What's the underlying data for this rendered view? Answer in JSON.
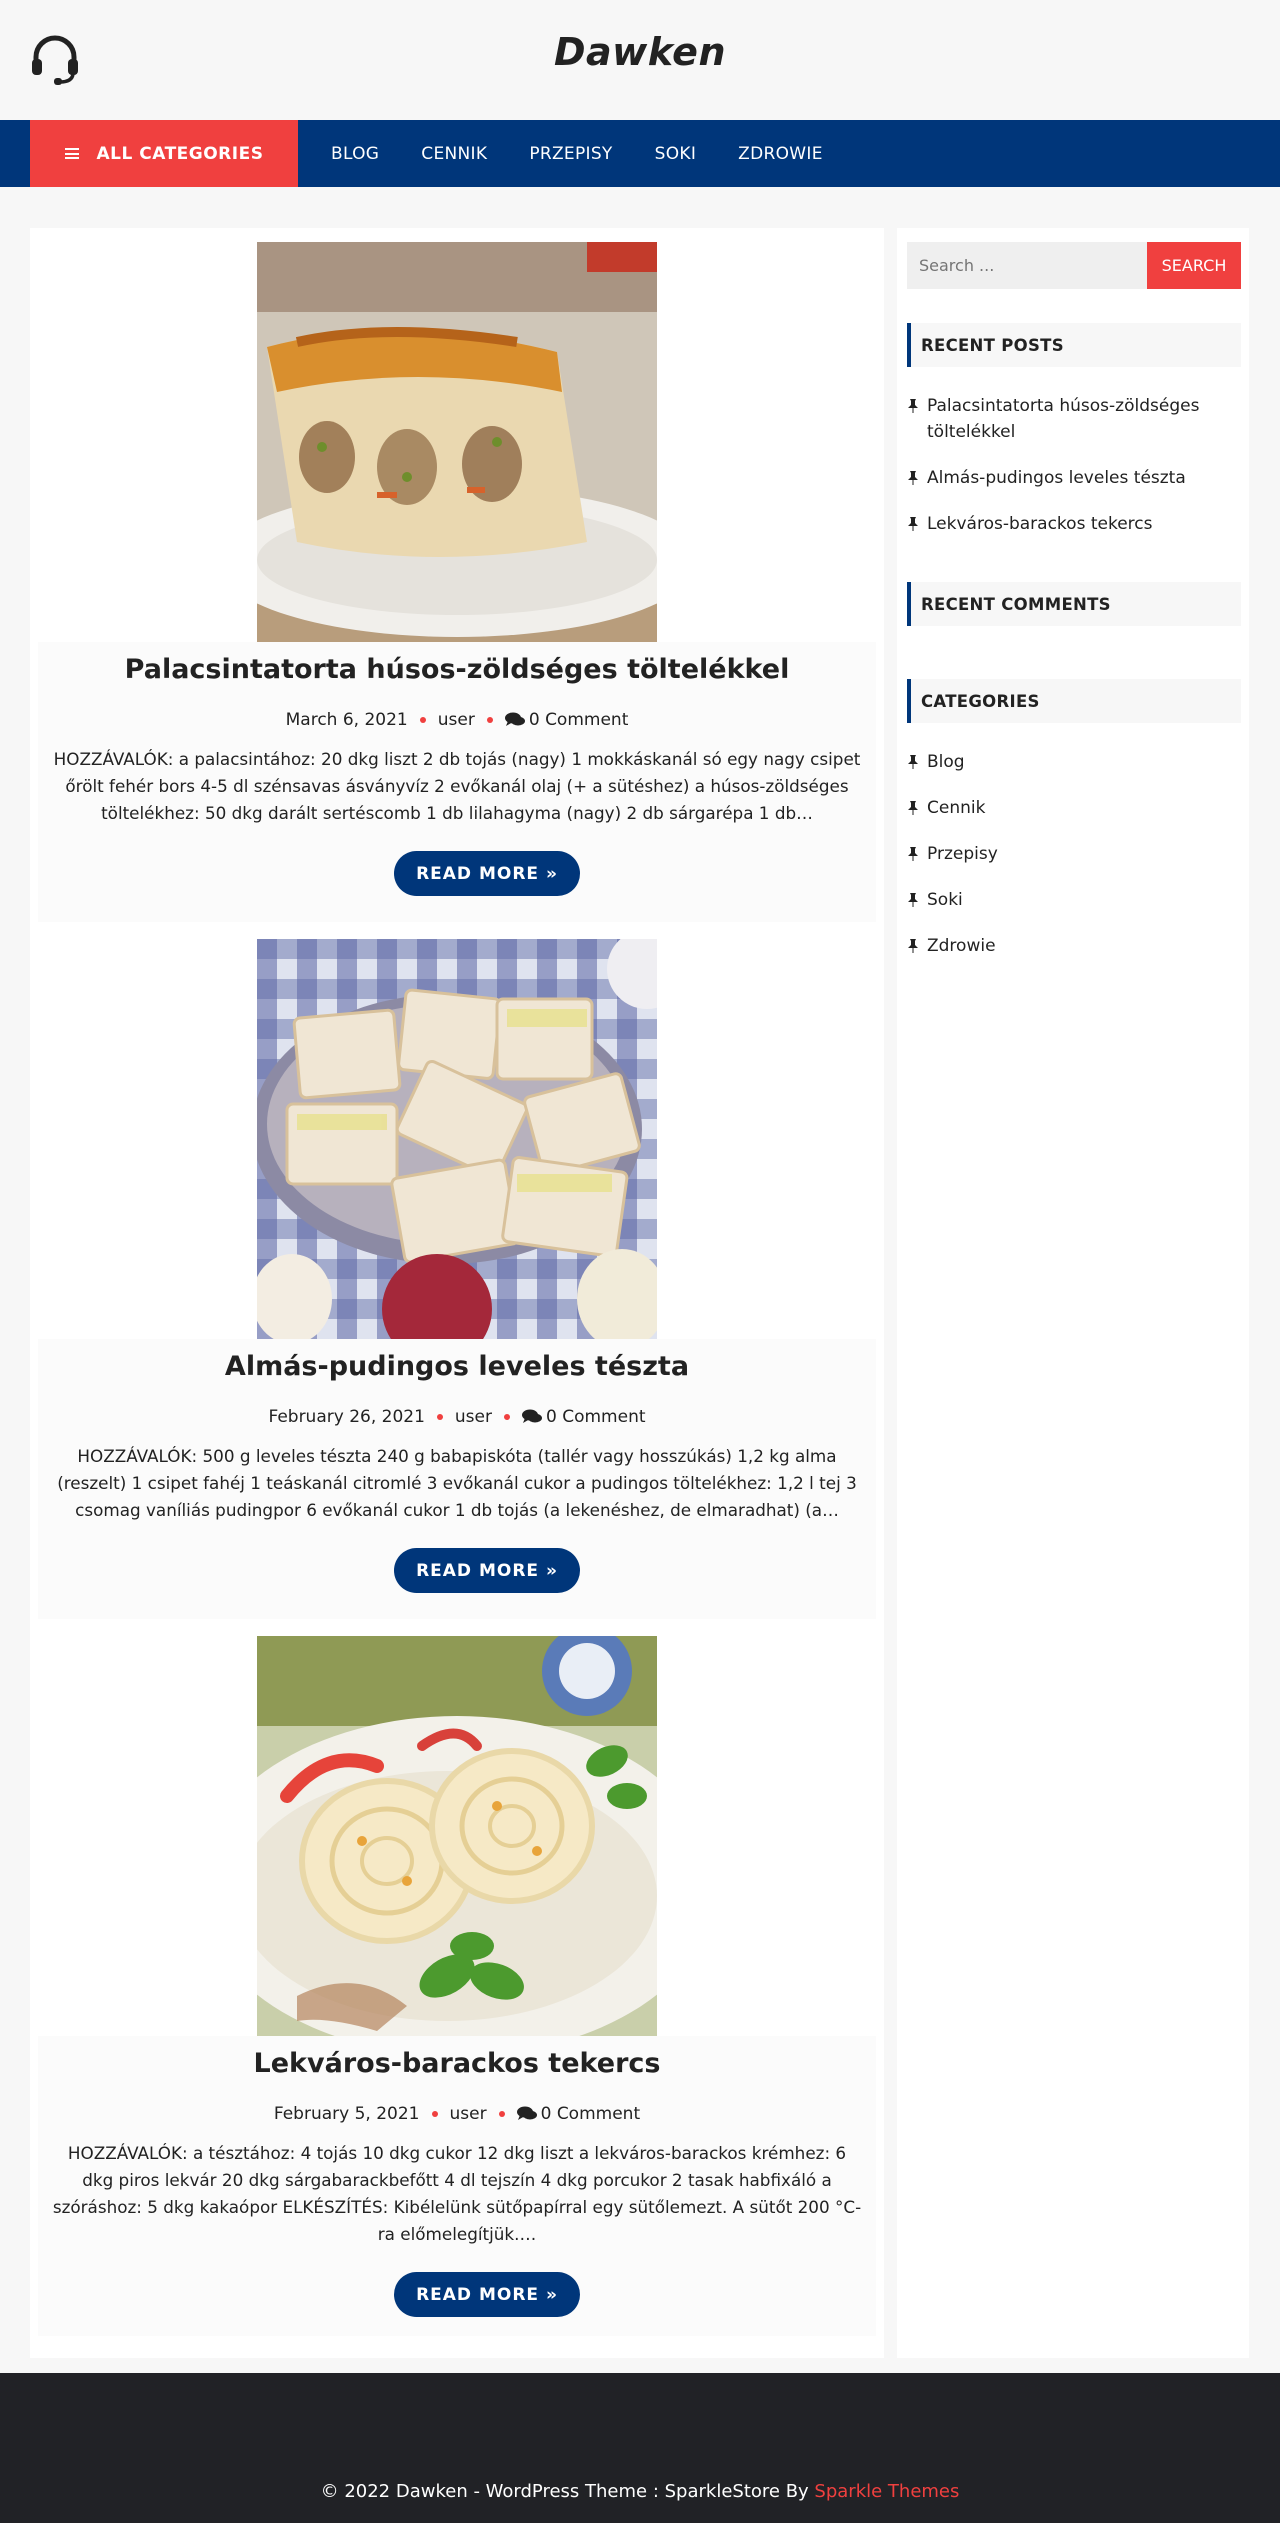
{
  "header": {
    "site_title": "Dawken",
    "logo_icon": "headset-icon"
  },
  "nav": {
    "all_categories": "ALL CATEGORIES",
    "items": [
      "BLOG",
      "CENNIK",
      "PRZEPISY",
      "SOKI",
      "ZDROWIE"
    ]
  },
  "posts": [
    {
      "title": "Palacsintatorta húsos-zöldséges töltelékkel",
      "date": "March 6, 2021",
      "author": "user",
      "comments": "0 Comment",
      "excerpt": "HOZZÁVALÓK: a palacsintához: 20 dkg liszt 2 db tojás (nagy) 1 mokkáskanál só egy nagy csipet őrölt fehér bors 4-5 dl szénsavas ásványvíz 2 evőkanál olaj (+ a sütéshez) a húsos-zöldséges töltelékhez: 50 dkg darált sertéscomb 1 db lilahagyma (nagy) 2 db sárgarépa 1 db…",
      "read_more": "READ MORE »"
    },
    {
      "title": "Almás-pudingos leveles tészta",
      "date": "February 26, 2021",
      "author": "user",
      "comments": "0 Comment",
      "excerpt": "HOZZÁVALÓK: 500 g leveles tészta 240 g babapiskóta (tallér vagy hosszúkás) 1,2 kg alma (reszelt) 1 csipet fahéj 1 teáskanál citromlé 3 evőkanál cukor a pudingos töltelékhez: 1,2 l tej 3 csomag vaníliás pudingpor 6 evőkanál cukor 1 db tojás (a lekenéshez, de elmaradhat) (a…",
      "read_more": "READ MORE »"
    },
    {
      "title": "Lekváros-barackos tekercs",
      "date": "February 5, 2021",
      "author": "user",
      "comments": "0 Comment",
      "excerpt": "HOZZÁVALÓK: a tésztához: 4 tojás 10 dkg cukor 12 dkg liszt a lekváros-barackos krémhez: 6 dkg piros lekvár 20 dkg sárgabarackbefőtt 4 dl tejszín 4 dkg porcukor 2 tasak habfixáló a szóráshoz: 5 dkg kakaópor ELKÉSZÍTÉS: Kibélelünk sütőpapírral egy sütőlemezt. A sütőt 200 °C-ra előmelegítjük.…",
      "read_more": "READ MORE »"
    }
  ],
  "sidebar": {
    "search_placeholder": "Search ...",
    "search_button": "SEARCH",
    "recent_posts_title": "RECENT POSTS",
    "recent_posts": [
      "Palacsintatorta húsos-zöldséges töltelékkel",
      "Almás-pudingos leveles tészta",
      "Lekváros-barackos tekercs"
    ],
    "recent_comments_title": "RECENT COMMENTS",
    "categories_title": "CATEGORIES",
    "categories": [
      "Blog",
      "Cennik",
      "Przepisy",
      "Soki",
      "Zdrowie"
    ]
  },
  "footer": {
    "copyright": "© 2022 Dawken - WordPress Theme : SparkleStore By ",
    "link": "Sparkle Themes"
  },
  "colors": {
    "nav": "#00367a",
    "accent": "#f0403f",
    "footer": "#212226"
  }
}
